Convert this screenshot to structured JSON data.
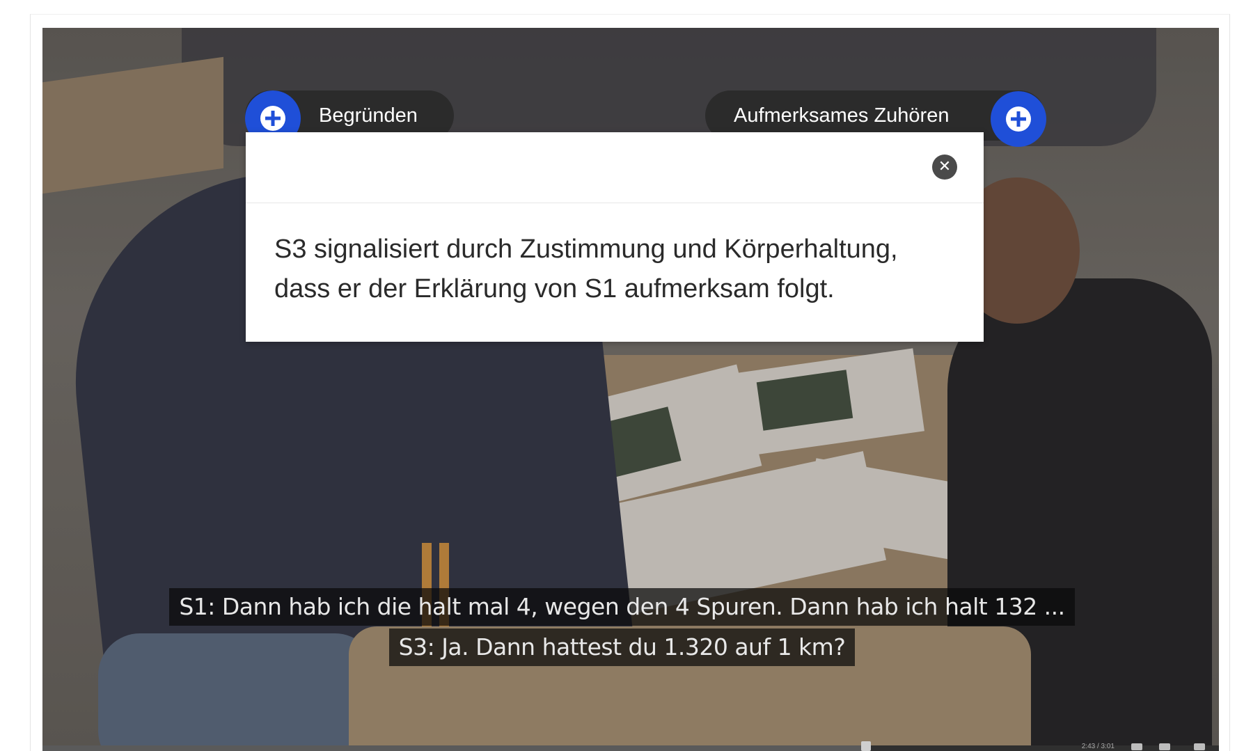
{
  "video": {
    "tags": {
      "left_label": "Begründen",
      "right_label": "Aufmerksames Zuhören"
    },
    "progress_fraction": 0.7,
    "time_display": "2:43 / 3:01"
  },
  "popup": {
    "text": "S3 signalisiert durch Zustimmung und Körperhaltung, dass er der Erklärung von S1 aufmerksam folgt."
  },
  "subtitles": [
    "S1: Dann hab ich die halt mal 4, wegen den 4 Spuren. Dann hab ich halt 132 ...",
    "S3: Ja. Dann hattest du 1.320 auf 1 km?"
  ],
  "colors": {
    "accent": "#1f4fd8",
    "tag_background": "#2b2b2b"
  },
  "icons": {
    "tag_button": "plus-circle-icon",
    "close": "close-circle-icon"
  }
}
